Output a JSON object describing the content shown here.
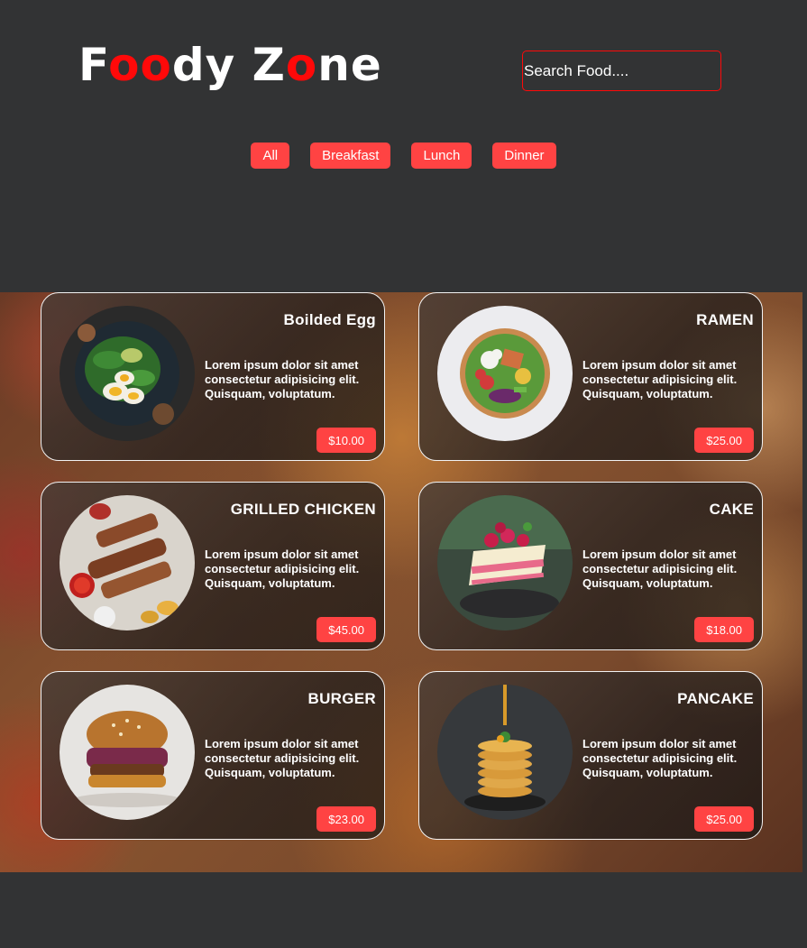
{
  "header": {
    "logo": [
      {
        "t": "F",
        "red": false
      },
      {
        "t": "oo",
        "red": true
      },
      {
        "t": "dy Z",
        "red": false
      },
      {
        "t": "o",
        "red": true
      },
      {
        "t": "ne",
        "red": false
      }
    ],
    "search_placeholder": "Search Food...."
  },
  "filters": [
    "All",
    "Breakfast",
    "Lunch",
    "Dinner"
  ],
  "colors": {
    "accent": "#ff4343",
    "logo_red": "#ff0909",
    "background": "#323334"
  },
  "foods": [
    {
      "name": "Boilded Egg",
      "description": "Lorem ipsum dolor sit amet consectetur adipisicing elit. Quisquam, voluptatum.",
      "price": "$10.00",
      "image": "egg-salad"
    },
    {
      "name": "RAMEN",
      "description": "Lorem ipsum dolor sit amet consectetur adipisicing elit. Quisquam, voluptatum.",
      "price": "$25.00",
      "image": "salad-bowl"
    },
    {
      "name": "GRILLED CHICKEN",
      "description": "Lorem ipsum dolor sit amet consectetur adipisicing elit. Quisquam, voluptatum.",
      "price": "$45.00",
      "image": "grilled-platter"
    },
    {
      "name": "CAKE",
      "description": "Lorem ipsum dolor sit amet consectetur adipisicing elit. Quisquam, voluptatum.",
      "price": "$18.00",
      "image": "raspberry-cake"
    },
    {
      "name": "BURGER",
      "description": "Lorem ipsum dolor sit amet consectetur adipisicing elit. Quisquam, voluptatum.",
      "price": "$23.00",
      "image": "burger"
    },
    {
      "name": "PANCAKE",
      "description": "Lorem ipsum dolor sit amet consectetur adipisicing elit. Quisquam, voluptatum.",
      "price": "$25.00",
      "image": "pancake-stack"
    }
  ]
}
